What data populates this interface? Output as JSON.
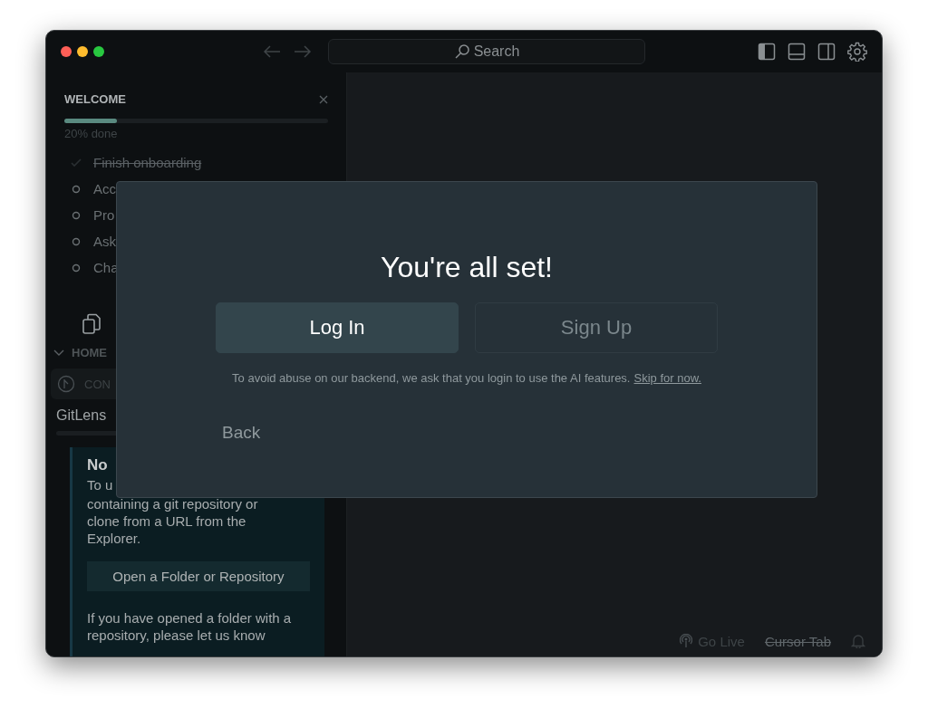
{
  "titlebar": {
    "search": "Search"
  },
  "welcome": {
    "title": "WELCOME",
    "progress": {
      "level": 0.2,
      "text": "20% done"
    },
    "steps": [
      {
        "label": "Finish onboarding",
        "done": true
      },
      {
        "label": "Acc",
        "done": false
      },
      {
        "label": "Pro",
        "done": false
      },
      {
        "label": "Ask",
        "done": false
      },
      {
        "label": "Cha",
        "done": false
      }
    ]
  },
  "home": {
    "title": "HOME",
    "row": "CON"
  },
  "gitlens": {
    "title": "GitLens",
    "card": {
      "title": "No",
      "first_line": "To u",
      "text": "containing a git repository or clone from a URL from the Explorer.",
      "button": "Open a Folder or Repository",
      "note": "If you have opened a folder with a repository, please let us know"
    }
  },
  "dialog": {
    "title": "You're all set!",
    "buttons": [
      {
        "label": "Log In",
        "primary": true
      },
      {
        "label": "Sign Up",
        "primary": false
      }
    ],
    "notice": "To avoid abuse on our backend, we ask that you login to use the AI features.",
    "skip_link": "Skip for now.",
    "back": "Back"
  },
  "status_bar": [
    {
      "kind": "live",
      "label": "Go Live"
    },
    {
      "kind": "disabled",
      "label": "Cursor Tab"
    }
  ]
}
